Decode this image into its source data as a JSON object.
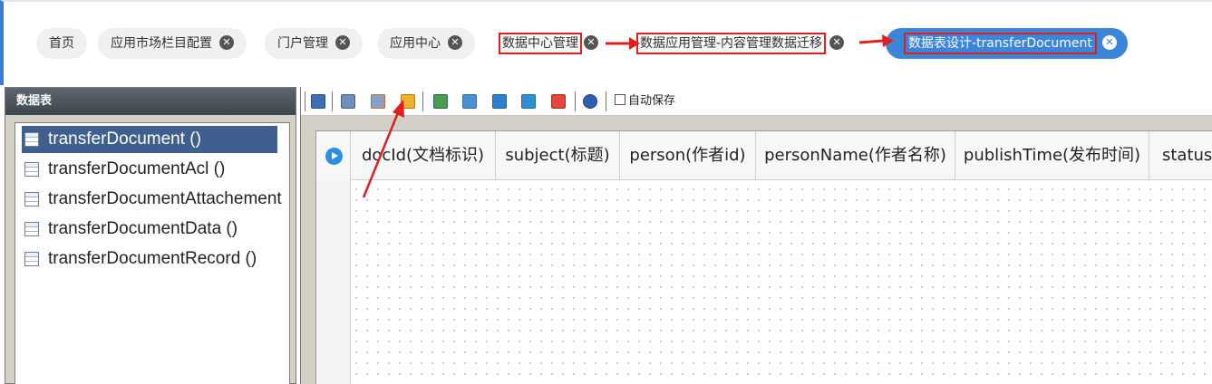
{
  "tabs": [
    {
      "label": "首页",
      "closable": false
    },
    {
      "label": "应用市场栏目配置",
      "closable": true
    },
    {
      "label": "门户管理",
      "closable": true
    },
    {
      "label": "应用中心",
      "closable": true
    },
    {
      "label": "数据中心管理",
      "closable": true
    },
    {
      "label": "数据应用管理-内容管理数据迁移",
      "closable": true
    },
    {
      "label": "数据表设计-transferDocument",
      "closable": true,
      "active": true
    }
  ],
  "left_panel": {
    "title": "数据表",
    "items": [
      {
        "label": "transferDocument ()",
        "selected": true
      },
      {
        "label": "transferDocumentAcl ()",
        "selected": false
      },
      {
        "label": "transferDocumentAttachement",
        "selected": false
      },
      {
        "label": "transferDocumentData ()",
        "selected": false
      },
      {
        "label": "transferDocumentRecord ()",
        "selected": false
      }
    ]
  },
  "toolbar": {
    "autosave_label": "自动保存",
    "icons": [
      "save-icon",
      "copy-icon",
      "export-icon",
      "grid-icon",
      "import-icon",
      "import-down-icon",
      "word-icon",
      "excel-icon",
      "clear-icon",
      "help-icon"
    ]
  },
  "grid": {
    "columns": [
      "docId(文档标识)",
      "subject(标题)",
      "person(作者id)",
      "personName(作者名称)",
      "publishTime(发布时间)",
      "status("
    ]
  },
  "colors": {
    "accent": "#3b86d9",
    "highlight_red": "#e02020",
    "header_dark": "#4a5058"
  }
}
